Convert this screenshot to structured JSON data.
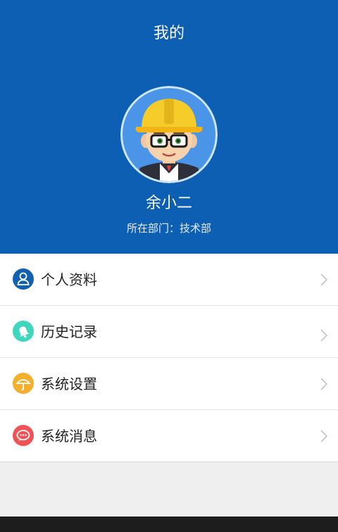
{
  "header": {
    "title": "我的"
  },
  "profile": {
    "name": "余小二",
    "department_label": "所在部门：",
    "department_value": "技术部",
    "avatar_icon": "worker-avatar-icon"
  },
  "menu": {
    "items": [
      {
        "label": "个人资料",
        "icon": "person-icon",
        "color": "#1260b0"
      },
      {
        "label": "历史记录",
        "icon": "bell-icon",
        "color": "#3ed6bd"
      },
      {
        "label": "系统设置",
        "icon": "umbrella-icon",
        "color": "#f2b02c"
      },
      {
        "label": "系统消息",
        "icon": "chat-bubble-icon",
        "color": "#ef5356"
      }
    ]
  },
  "colors": {
    "header_bg": "#0d5fb4",
    "page_bg": "#efefef"
  }
}
